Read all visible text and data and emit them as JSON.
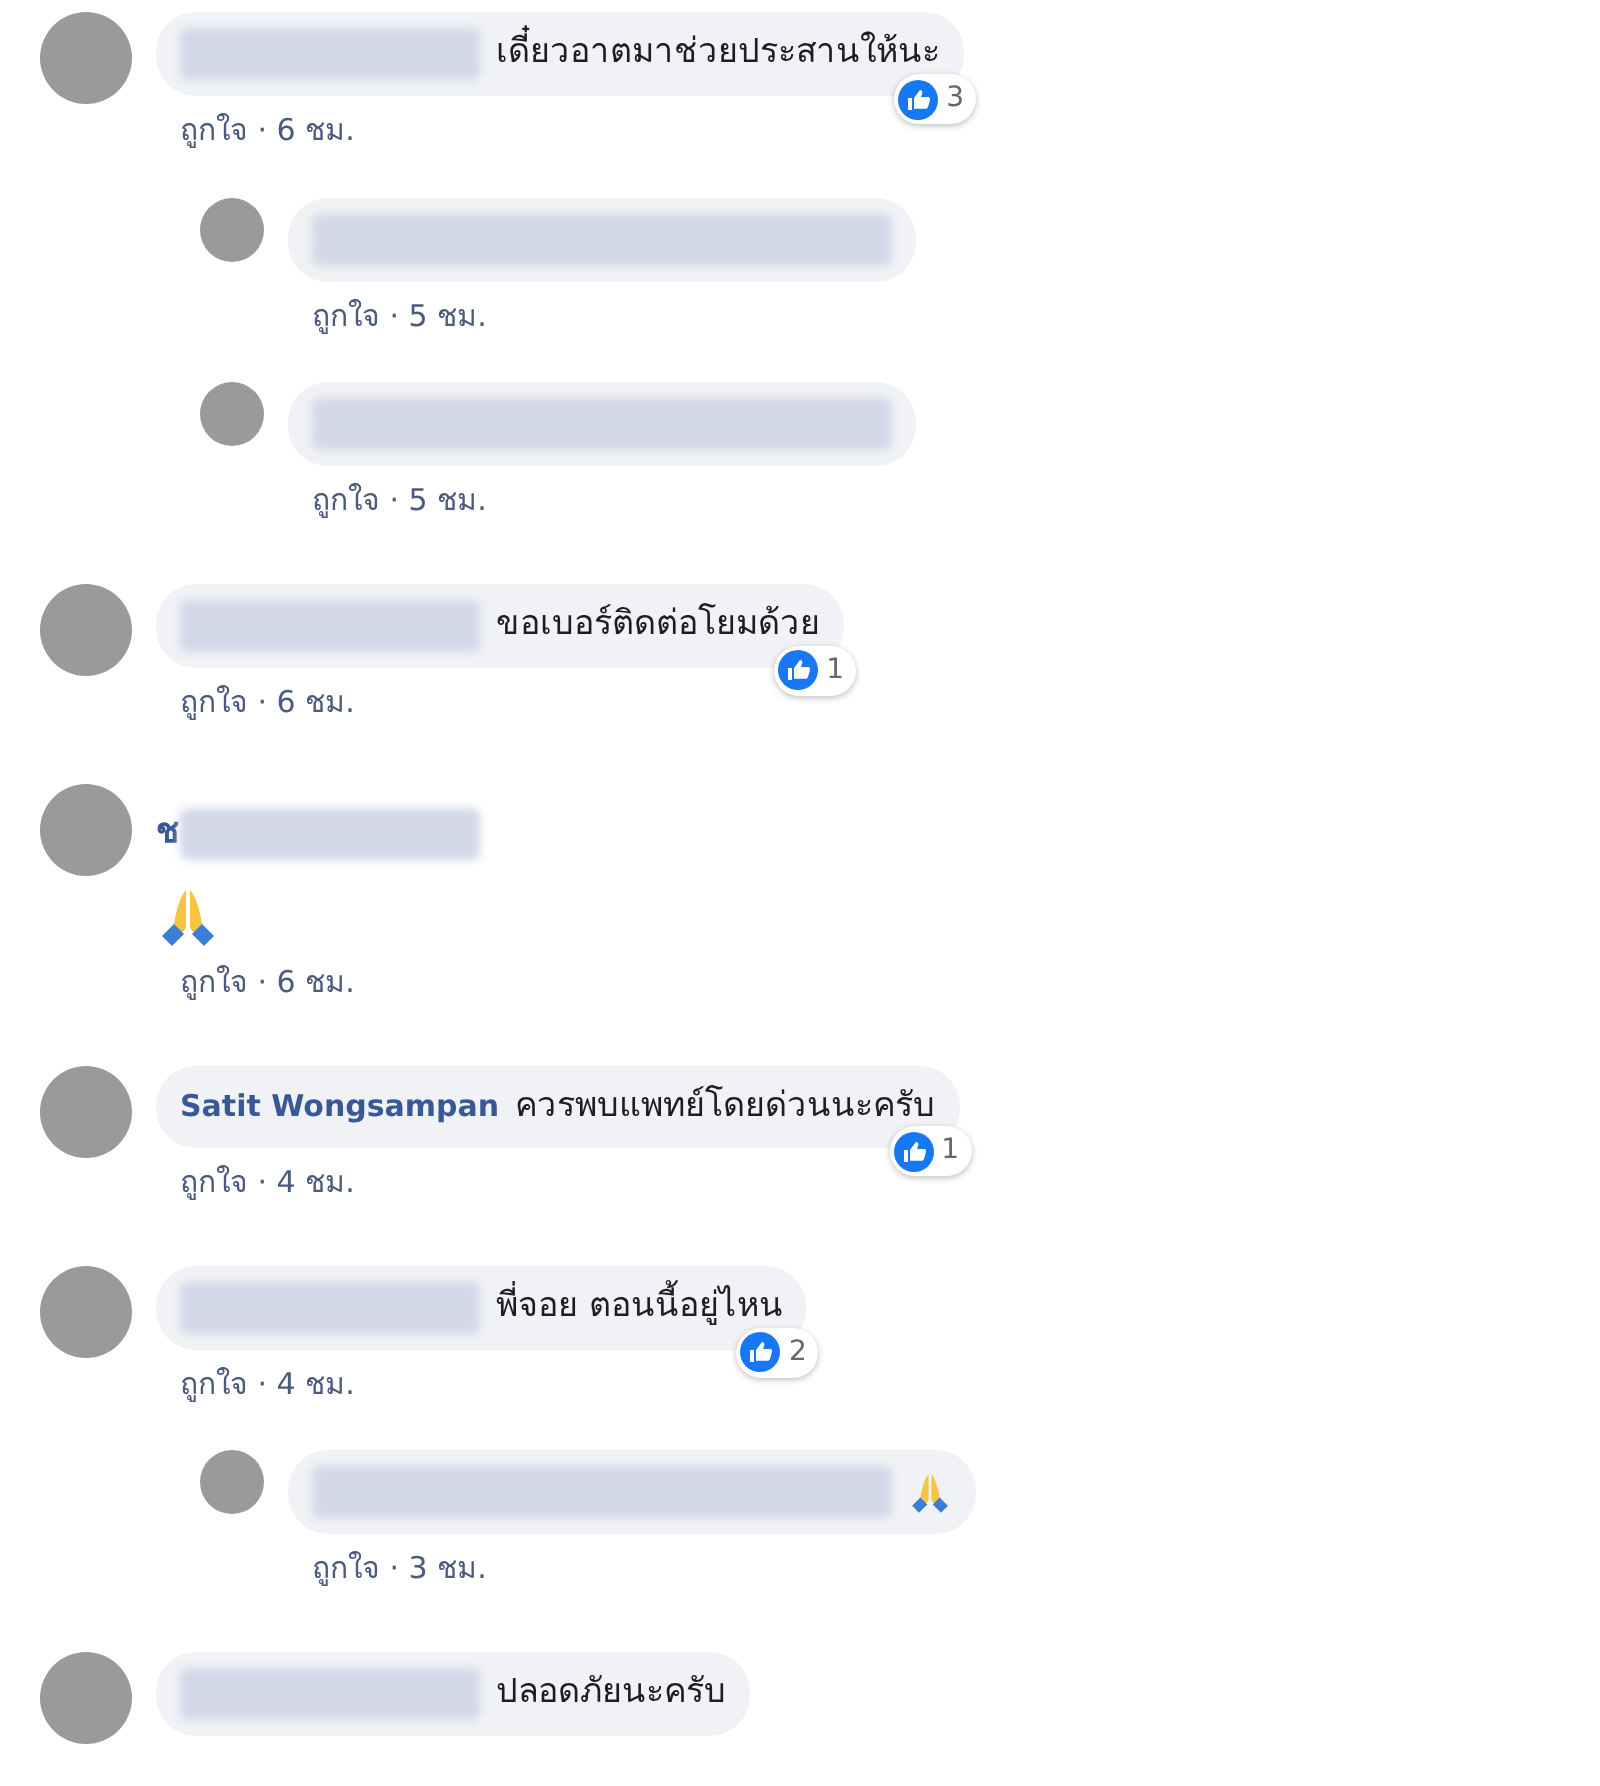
{
  "comments": [
    {
      "kind": "comment",
      "name_blurred": true,
      "text": "เดี๋ยวอาตมาช่วยประสานให้นะ",
      "likes": "3",
      "meta": "ถูกใจ · 6 ชม.",
      "replies": [
        {
          "kind": "reply",
          "body_blurred": true,
          "meta": "ถูกใจ · 5 ชม."
        },
        {
          "kind": "reply",
          "body_blurred": true,
          "meta": "ถูกใจ · 5 ชม."
        }
      ]
    },
    {
      "kind": "comment",
      "name_blurred": true,
      "text": "ขอเบอร์ติดต่อโยมด้วย",
      "likes": "1",
      "meta": "ถูกใจ · 6 ชม."
    },
    {
      "kind": "emoji",
      "name": "ช",
      "name_blurred": true,
      "meta": "ถูกใจ · 6 ชม."
    },
    {
      "kind": "comment",
      "name": "Satit Wongsampan",
      "text": "ควรพบแพทย์โดยด่วนนะครับ",
      "likes": "1",
      "meta": "ถูกใจ · 4 ชม."
    },
    {
      "kind": "comment",
      "name_blurred": true,
      "text": "พี่จอย ตอนนี้อยู่ไหน",
      "likes": "2",
      "meta": "ถูกใจ · 4 ชม.",
      "replies": [
        {
          "kind": "reply",
          "body_blurred": true,
          "ends_with_emoji": true,
          "meta": "ถูกใจ · 3 ชม."
        }
      ]
    },
    {
      "kind": "comment",
      "name_blurred": true,
      "text": "ปลอดภัยนะครับ"
    }
  ]
}
